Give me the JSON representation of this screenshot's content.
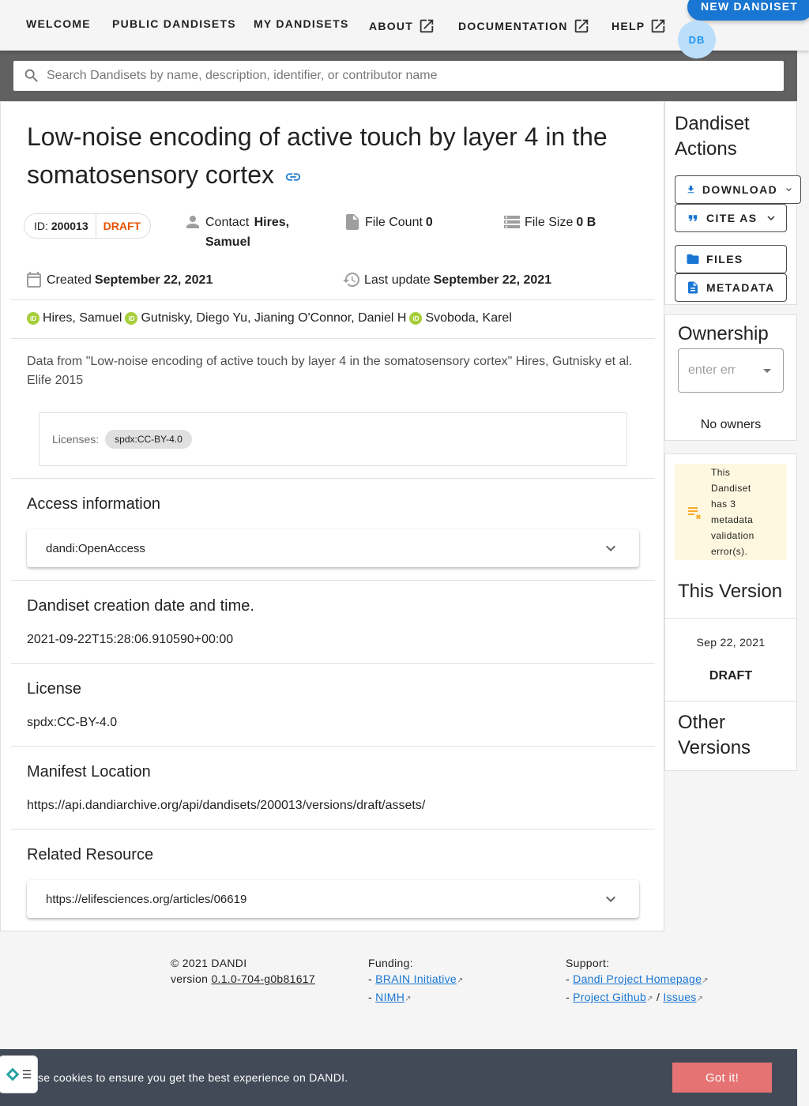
{
  "nav": {
    "welcome": "WELCOME",
    "public": "PUBLIC DANDISETS",
    "mine": "MY DANDISETS",
    "about": "ABOUT",
    "docs": "DOCUMENTATION",
    "help": "HELP",
    "new_dandiset": "NEW DANDISET",
    "avatar": "DB"
  },
  "search": {
    "placeholder": "Search Dandisets by name, description, identifier, or contributor name"
  },
  "dandiset": {
    "title": "Low-noise encoding of active touch by layer 4 in the somatosensory cortex",
    "id_label": "ID:",
    "id": "200013",
    "status": "DRAFT",
    "contact_label": "Contact",
    "contact": "Hires, Samuel",
    "file_count_label": "File Count",
    "file_count": "0",
    "file_size_label": "File Size",
    "file_size": "0 B",
    "created_label": "Created",
    "created": "September 22, 2021",
    "updated_label": "Last update",
    "updated": "September 22, 2021",
    "contributors": [
      "Hires, Samuel",
      "Gutnisky, Diego Yu, Jianing O'Connor, Daniel H",
      "Svoboda, Karel"
    ],
    "description": "Data from \"Low-noise encoding of active touch by layer 4 in the somatosensory cortex\" Hires, Gutnisky et al. Elife 2015",
    "licenses_label": "Licenses:",
    "license_chip": "spdx:CC-BY-4.0"
  },
  "sections": {
    "access_title": "Access information",
    "access_value": "dandi:OpenAccess",
    "creation_title": "Dandiset creation date and time.",
    "creation_value": "2021-09-22T15:28:06.910590+00:00",
    "license_title": "License",
    "license_value": "spdx:CC-BY-4.0",
    "manifest_title": "Manifest Location",
    "manifest_value": "https://api.dandiarchive.org/api/dandisets/200013/versions/draft/assets/",
    "related_title": "Related Resource",
    "related_value": "https://elifesciences.org/articles/06619"
  },
  "sidebar": {
    "actions_title": "Dandiset Actions",
    "download": "DOWNLOAD",
    "cite": "CITE AS",
    "files": "FILES",
    "metadata": "METADATA",
    "ownership_title": "Ownership",
    "owner_placeholder": "enter em",
    "no_owners": "No owners",
    "validation_warning": "This Dandiset has 3 metadata validation error(s).",
    "this_version_title": "This Version",
    "version_date": "Sep 22, 2021",
    "version_name": "DRAFT",
    "other_versions_title": "Other Versions"
  },
  "footer": {
    "copyright": "© 2021 DANDI",
    "version_label": "version",
    "version": "0.1.0-704-g0b81617",
    "funding_label": "Funding:",
    "funding_links": [
      "BRAIN Initiative",
      "NIMH"
    ],
    "support_label": "Support:",
    "support_links": [
      "Dandi Project Homepage",
      "Project Github",
      "Issues"
    ]
  },
  "cookie": {
    "text": "se cookies to ensure you get the best experience on DANDI.",
    "button": "Got it!"
  },
  "colors": {
    "primary": "#1976d2",
    "draft": "#e65100",
    "orcid": "#a6ce39",
    "warning_bg": "#fff8e1",
    "cookie_bg": "#424a57",
    "cookie_btn": "#e57373"
  }
}
